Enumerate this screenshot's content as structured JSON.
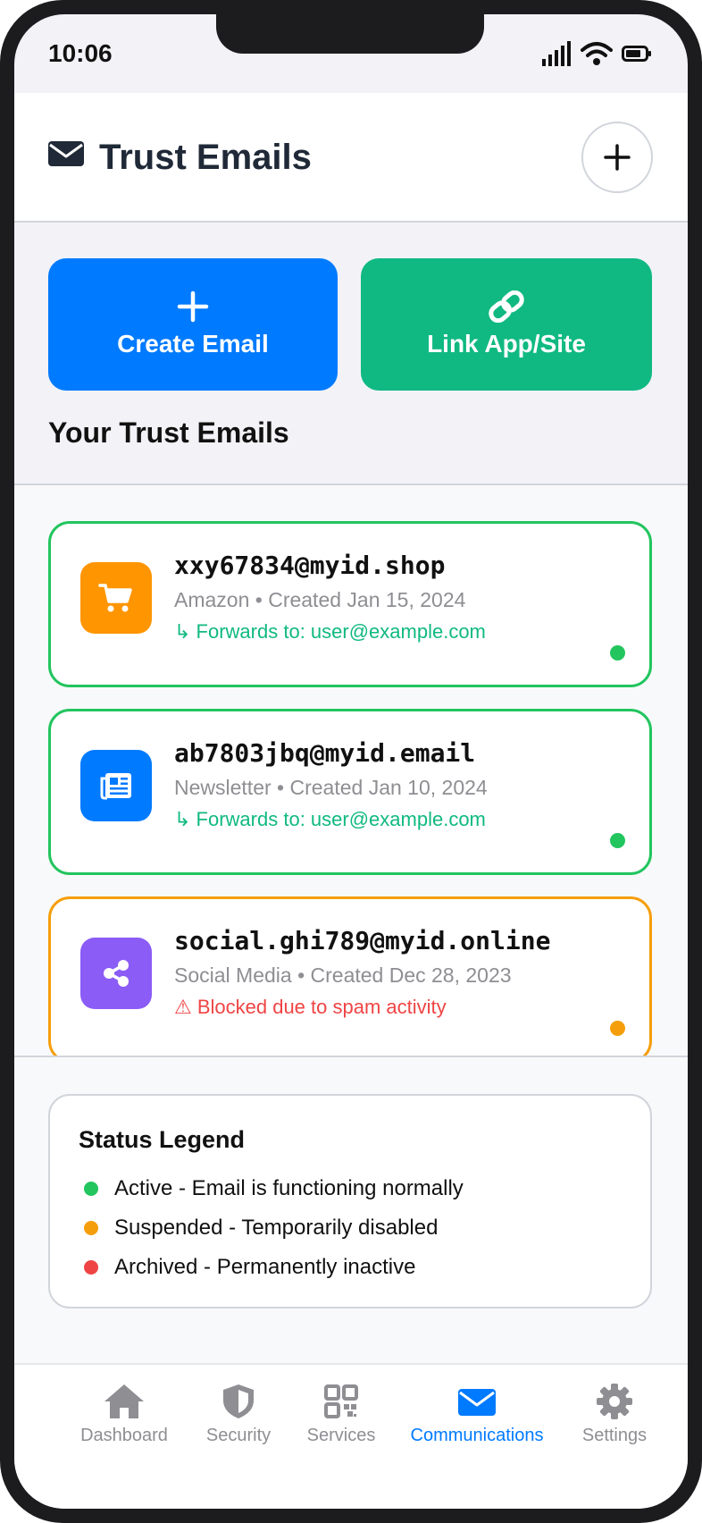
{
  "status_bar": {
    "time": "10:06"
  },
  "header": {
    "title": "Trust Emails",
    "icon": "envelope-icon",
    "add_icon": "plus-icon"
  },
  "actions": {
    "create": {
      "label": "Create Email",
      "icon": "plus-icon",
      "color": "#007aff"
    },
    "link": {
      "label": "Link App/Site",
      "icon": "link-icon",
      "color": "#10b981"
    }
  },
  "section_title": "Your Trust Emails",
  "emails": [
    {
      "address": "xxy67834@myid.shop",
      "meta": "Amazon • Created Jan 15, 2024",
      "note": "↳ Forwards to: user@example.com",
      "icon": "shopping-cart-icon",
      "icon_color": "#ff9500",
      "status": "active",
      "status_color": "#22c55e"
    },
    {
      "address": "ab7803jbq@myid.email",
      "meta": "Newsletter • Created Jan 10, 2024",
      "note": "↳ Forwards to: user@example.com",
      "icon": "newspaper-icon",
      "icon_color": "#007aff",
      "status": "active",
      "status_color": "#22c55e"
    },
    {
      "address": "social.ghi789@myid.online",
      "meta": "Social Media • Created Dec 28, 2023",
      "note": "⚠ Blocked due to spam activity",
      "icon": "share-icon",
      "icon_color": "#8b5cf6",
      "status": "suspended",
      "status_color": "#f59e0b"
    }
  ],
  "legend": {
    "title": "Status Legend",
    "items": [
      {
        "label": "Active - Email is functioning normally",
        "color": "#22c55e"
      },
      {
        "label": "Suspended - Temporarily disabled",
        "color": "#f59e0b"
      },
      {
        "label": "Archived - Permanently inactive",
        "color": "#ef4444"
      }
    ]
  },
  "tabs": [
    {
      "label": "Dashboard",
      "icon": "home-icon",
      "active": false
    },
    {
      "label": "Security",
      "icon": "shield-icon",
      "active": false
    },
    {
      "label": "Services",
      "icon": "qr-code-icon",
      "active": false
    },
    {
      "label": "Communications",
      "icon": "envelope-icon",
      "active": true
    },
    {
      "label": "Settings",
      "icon": "gear-icon",
      "active": false
    }
  ]
}
